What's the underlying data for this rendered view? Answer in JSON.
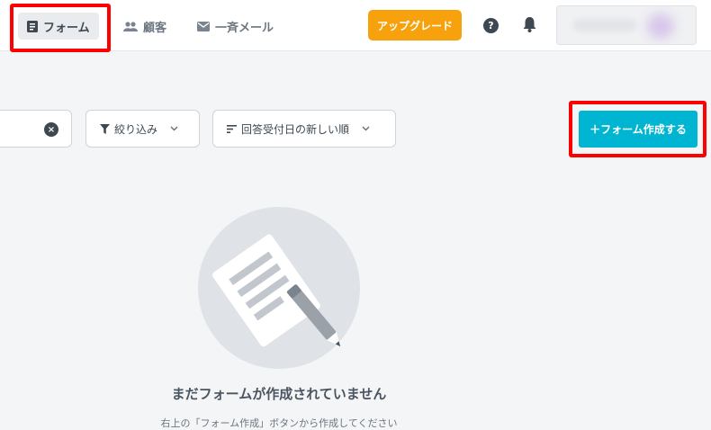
{
  "nav": {
    "forms_label": "フォーム",
    "customers_label": "顧客",
    "mail_label": "一斉メール"
  },
  "header": {
    "upgrade_label": "アップグレード",
    "help_label": "?"
  },
  "toolbar": {
    "clear_label": "×",
    "filter_label": "絞り込み",
    "sort_label": "回答受付日の新しい順",
    "create_label": "＋フォーム作成する"
  },
  "empty": {
    "title": "まだフォームが作成されていません",
    "subtitle": "右上の「フォーム作成」ボタンから作成してください"
  },
  "colors": {
    "upgrade": "#f7a20c",
    "create_button": "#00b5d1",
    "highlight": "#ff0000",
    "dark_text": "#3d4852"
  },
  "icons": [
    "form-icon",
    "users-icon",
    "mail-icon",
    "help-icon",
    "bell-icon",
    "clear-icon",
    "filter-icon",
    "sort-icon",
    "chevron-down-icon"
  ]
}
